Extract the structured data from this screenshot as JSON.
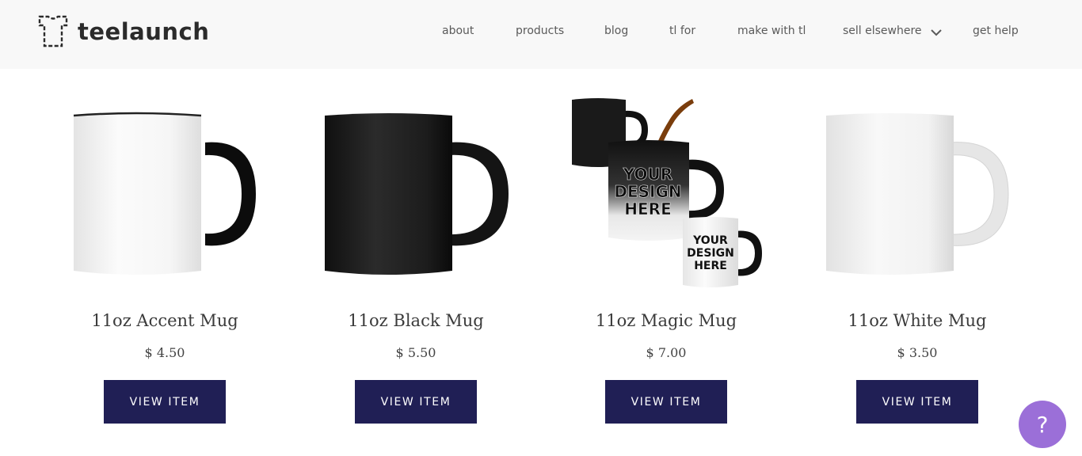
{
  "brand": {
    "name": "teelaunch",
    "logo_icon": "tshirt-outline-icon"
  },
  "nav": {
    "items": [
      {
        "label": "about"
      },
      {
        "label": "products"
      },
      {
        "label": "blog"
      },
      {
        "label": "tl for"
      },
      {
        "label": "make with tl"
      },
      {
        "label": "sell elsewhere",
        "has_dropdown": true
      },
      {
        "label": "get help"
      }
    ],
    "dropdown_icon": "chevron-down-icon"
  },
  "products": [
    {
      "name": "11oz Accent Mug",
      "price": "$ 4.50",
      "button_label": "VIEW ITEM",
      "image": "accent-mug-image"
    },
    {
      "name": "11oz Black Mug",
      "price": "$ 5.50",
      "button_label": "VIEW ITEM",
      "image": "black-mug-image"
    },
    {
      "name": "11oz Magic Mug",
      "price": "$ 7.00",
      "button_label": "VIEW ITEM",
      "image": "magic-mug-image",
      "image_text": "YOUR DESIGN HERE"
    },
    {
      "name": "11oz White Mug",
      "price": "$ 3.50",
      "button_label": "VIEW ITEM",
      "image": "white-mug-image"
    }
  ],
  "help": {
    "label": "?",
    "icon": "question-icon"
  },
  "colors": {
    "header_bg": "#f8f8f8",
    "button_bg": "#201f55",
    "help_bg": "#9b6fd8"
  }
}
